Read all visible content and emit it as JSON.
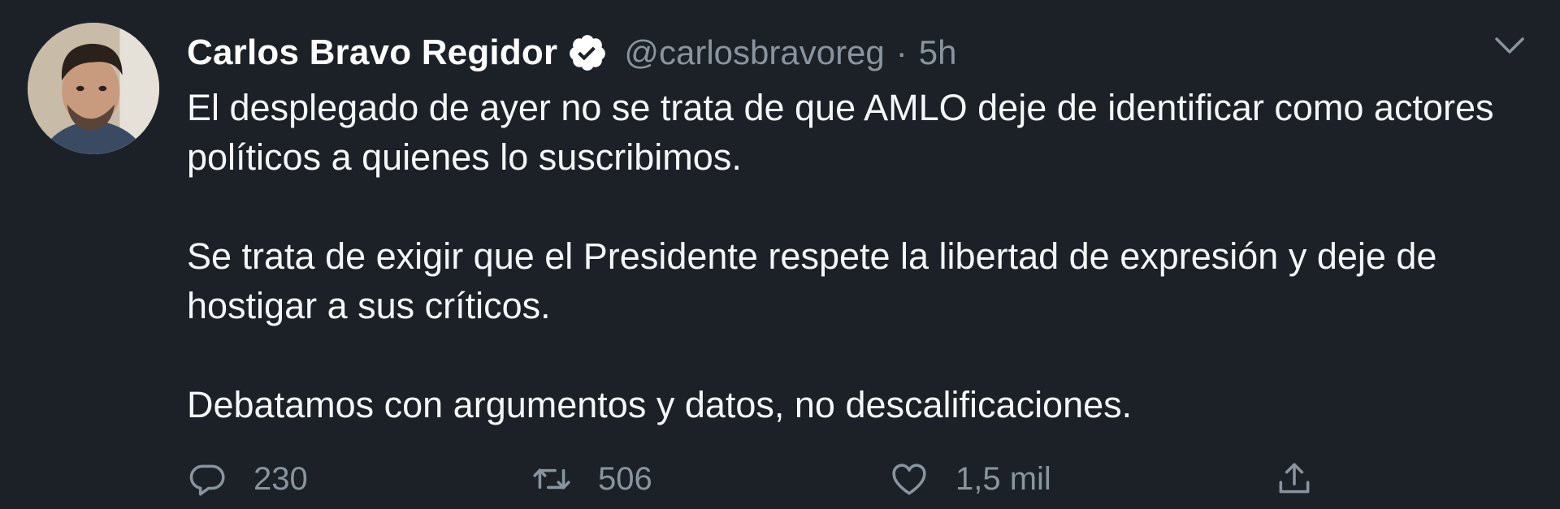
{
  "tweet": {
    "author": {
      "name": "Carlos Bravo Regidor",
      "handle": "@carlosbravoreg",
      "verified": true,
      "avatar_icon": "profile-photo"
    },
    "separator": "·",
    "time": "5h",
    "paragraphs": [
      "El desplegado de ayer no se trata de que AMLO deje de identificar como actores políticos a quienes lo suscribimos.",
      "Se trata de exigir que el Presidente respete la libertad de expresión y deje de hostigar a sus críticos.",
      "Debatamos con argumentos y datos, no descalificaciones."
    ],
    "actions": {
      "reply": {
        "icon": "reply-icon",
        "count": "230"
      },
      "retweet": {
        "icon": "retweet-icon",
        "count": "506"
      },
      "like": {
        "icon": "heart-icon",
        "count": "1,5 mil"
      },
      "share": {
        "icon": "share-icon"
      }
    }
  },
  "colors": {
    "background": "#1c2127",
    "text": "#f5f8fa",
    "secondary": "#8a949e"
  }
}
